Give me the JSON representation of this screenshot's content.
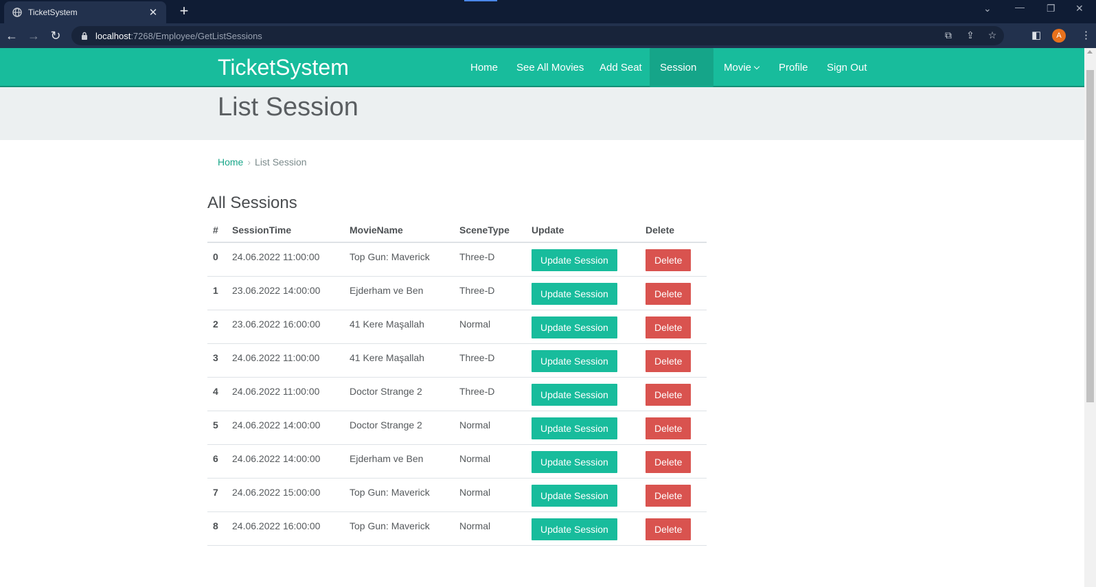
{
  "browser": {
    "tab_title": "TicketSystem",
    "url_host": "localhost",
    "url_path": ":7268/Employee/GetListSessions",
    "avatar_letter": "A"
  },
  "navbar": {
    "brand": "TicketSystem",
    "links": [
      "Home",
      "See All Movies",
      "Add Seat",
      "Session",
      "Movie",
      "Profile",
      "Sign Out"
    ],
    "active": "Session"
  },
  "header": {
    "title": "List Session"
  },
  "breadcrumb": {
    "home": "Home",
    "current": "List Session"
  },
  "section_title": "All Sessions",
  "table": {
    "headers": [
      "#",
      "SessionTime",
      "MovieName",
      "SceneType",
      "Update",
      "Delete"
    ],
    "update_label": "Update Session",
    "delete_label": "Delete",
    "rows": [
      {
        "index": "0",
        "time": "24.06.2022 11:00:00",
        "movie": "Top Gun: Maverick",
        "scene": "Three-D"
      },
      {
        "index": "1",
        "time": "23.06.2022 14:00:00",
        "movie": "Ejderham ve Ben",
        "scene": "Three-D"
      },
      {
        "index": "2",
        "time": "23.06.2022 16:00:00",
        "movie": "41 Kere Maşallah",
        "scene": "Normal"
      },
      {
        "index": "3",
        "time": "24.06.2022 11:00:00",
        "movie": "41 Kere Maşallah",
        "scene": "Three-D"
      },
      {
        "index": "4",
        "time": "24.06.2022 11:00:00",
        "movie": "Doctor Strange 2",
        "scene": "Three-D"
      },
      {
        "index": "5",
        "time": "24.06.2022 14:00:00",
        "movie": "Doctor Strange 2",
        "scene": "Normal"
      },
      {
        "index": "6",
        "time": "24.06.2022 14:00:00",
        "movie": "Ejderham ve Ben",
        "scene": "Normal"
      },
      {
        "index": "7",
        "time": "24.06.2022 15:00:00",
        "movie": "Top Gun: Maverick",
        "scene": "Normal"
      },
      {
        "index": "8",
        "time": "24.06.2022 16:00:00",
        "movie": "Top Gun: Maverick",
        "scene": "Normal"
      }
    ]
  },
  "colors": {
    "primary": "#18bc9c",
    "danger": "#d9534f",
    "header_bg": "#ecf0f1"
  }
}
